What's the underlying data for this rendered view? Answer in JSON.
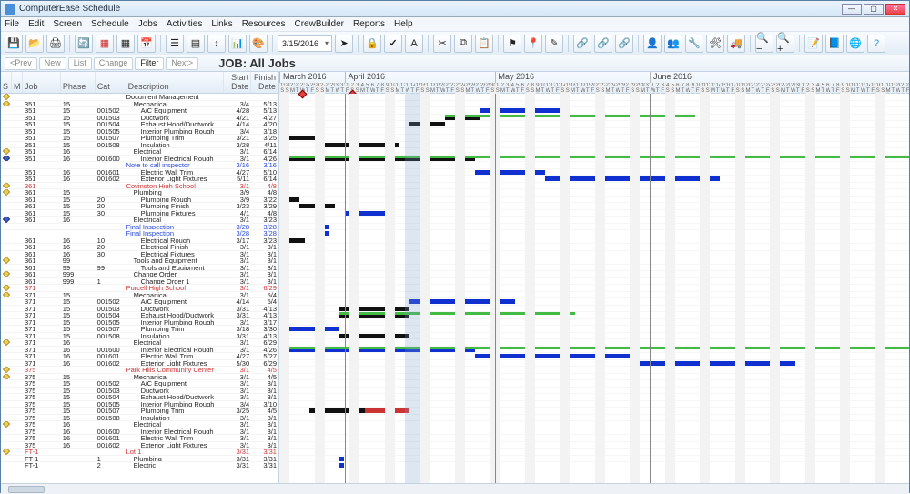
{
  "window": {
    "title": "ComputerEase Schedule"
  },
  "menus": [
    "File",
    "Edit",
    "Screen",
    "Schedule",
    "Jobs",
    "Activities",
    "Links",
    "Resources",
    "CrewBuilder",
    "Reports",
    "Help"
  ],
  "nav": {
    "prev": "<Prev",
    "new": "New",
    "list": "List",
    "change": "Change",
    "filter": "Filter",
    "next": "Next>"
  },
  "toolbar": {
    "date": "3/15/2016"
  },
  "heading": "JOB: All Jobs",
  "columns": {
    "s": "S",
    "m": "M",
    "job": "Job",
    "phase": "Phase",
    "cat": "Cat",
    "desc": "Description",
    "start": "Start Date",
    "finish": "Finish Date"
  },
  "months": [
    {
      "label": "March 2016",
      "start": 0
    },
    {
      "label": "April 2016",
      "start": 13
    },
    {
      "label": "May 2016",
      "start": 43
    },
    {
      "label": "June 2016",
      "start": 74
    }
  ],
  "timeline": {
    "startDay": 19,
    "totalDays": 126,
    "dayWidth": 5.5,
    "today": 26,
    "bandStart": 25,
    "bandWidth": 3
  },
  "rows": [
    {
      "m": "y",
      "job": "",
      "desc": "Document Management"
    },
    {
      "m": "y",
      "job": "351",
      "phase": "15",
      "desc": "Mechanical",
      "start": "3/4",
      "fin": "5/13"
    },
    {
      "job": "351",
      "phase": "15",
      "cat": "001502",
      "desc": "A/C Equipment",
      "start": "4/28",
      "fin": "5/13",
      "bars": [
        {
          "s": 40,
          "e": 55
        }
      ]
    },
    {
      "job": "351",
      "phase": "15",
      "cat": "001503",
      "desc": "Ductwork",
      "start": "4/21",
      "fin": "4/27",
      "bars": [
        {
          "s": 33,
          "e": 39,
          "cls": "blk"
        },
        {
          "s": 33,
          "e": 82,
          "cls": "grn"
        }
      ]
    },
    {
      "job": "351",
      "phase": "15",
      "cat": "001504",
      "desc": "Exhaust Hood/Ductwork",
      "start": "4/14",
      "fin": "4/20",
      "bars": [
        {
          "s": 26,
          "e": 32,
          "cls": "blk"
        }
      ]
    },
    {
      "job": "351",
      "phase": "15",
      "cat": "001505",
      "desc": "Interior Plumbing Rough",
      "start": "3/4",
      "fin": "3/18",
      "bars": [
        {
          "s": -15,
          "e": -1,
          "cls": "blk"
        }
      ]
    },
    {
      "job": "351",
      "phase": "15",
      "cat": "001507",
      "desc": "Plumbing Trim",
      "start": "3/21",
      "fin": "3/25",
      "bars": [
        {
          "s": 2,
          "e": 6,
          "cls": "blk"
        }
      ]
    },
    {
      "job": "351",
      "phase": "15",
      "cat": "001508",
      "desc": "Insulation",
      "start": "3/28",
      "fin": "4/11",
      "bars": [
        {
          "s": 9,
          "e": 23,
          "cls": "blk"
        }
      ]
    },
    {
      "m": "y",
      "job": "351",
      "phase": "16",
      "desc": "Electrical",
      "start": "3/1",
      "fin": "6/14"
    },
    {
      "m": "b",
      "job": "351",
      "phase": "16",
      "cat": "001600",
      "desc": "Interior Electrical Rough",
      "start": "3/1",
      "fin": "4/26",
      "bars": [
        {
          "s": -18,
          "e": 38,
          "cls": "blk"
        },
        {
          "s": -18,
          "e": 126,
          "cls": "grn"
        }
      ]
    },
    {
      "job": "",
      "desc": "Note to call inspector",
      "start": "3/16",
      "fin": "3/16",
      "cls": "blue"
    },
    {
      "job": "351",
      "phase": "16",
      "cat": "001601",
      "desc": "Electric Wall Trim",
      "start": "4/27",
      "fin": "5/10",
      "bars": [
        {
          "s": 39,
          "e": 52
        }
      ]
    },
    {
      "job": "351",
      "phase": "16",
      "cat": "001602",
      "desc": "Exterior Light Fixtures",
      "start": "5/11",
      "fin": "6/14",
      "bars": [
        {
          "s": 53,
          "e": 87
        }
      ]
    },
    {
      "m": "y",
      "job": "361",
      "desc": "Covington High School",
      "start": "3/1",
      "fin": "4/8",
      "cls": "red"
    },
    {
      "m": "y",
      "job": "361",
      "phase": "15",
      "desc": "Plumbing",
      "start": "3/9",
      "fin": "4/8"
    },
    {
      "job": "361",
      "phase": "15",
      "cat": "20",
      "desc": "Plumbing Rough",
      "start": "3/9",
      "fin": "3/22",
      "bars": [
        {
          "s": -10,
          "e": 3,
          "cls": "blk"
        }
      ]
    },
    {
      "job": "361",
      "phase": "15",
      "cat": "20",
      "desc": "Plumbing Finish",
      "start": "3/23",
      "fin": "3/29",
      "bars": [
        {
          "s": 4,
          "e": 10,
          "cls": "blk"
        }
      ]
    },
    {
      "job": "361",
      "phase": "15",
      "cat": "30",
      "desc": "Plumbing Fixtures",
      "start": "4/1",
      "fin": "4/8",
      "bars": [
        {
          "s": 13,
          "e": 20
        }
      ]
    },
    {
      "m": "b",
      "job": "361",
      "phase": "16",
      "desc": "Electrical",
      "start": "3/1",
      "fin": "3/23"
    },
    {
      "job": "",
      "desc": "Final Inspection",
      "start": "3/28",
      "fin": "3/28",
      "cls": "blue",
      "sq": 9
    },
    {
      "job": "",
      "desc": "Final Inspection",
      "start": "3/28",
      "fin": "3/28",
      "cls": "blue",
      "sq": 9
    },
    {
      "job": "361",
      "phase": "16",
      "cat": "10",
      "desc": "Electrical Rough",
      "start": "3/17",
      "fin": "3/23",
      "bars": [
        {
          "s": -2,
          "e": 4,
          "cls": "blk"
        }
      ]
    },
    {
      "job": "361",
      "phase": "16",
      "cat": "20",
      "desc": "Electrical Finish",
      "start": "3/1",
      "fin": "3/1"
    },
    {
      "job": "361",
      "phase": "16",
      "cat": "30",
      "desc": "Electrical Fixtures",
      "start": "3/1",
      "fin": "3/1"
    },
    {
      "m": "y",
      "job": "361",
      "phase": "99",
      "desc": "Tools and Equipment",
      "start": "3/1",
      "fin": "3/1"
    },
    {
      "job": "361",
      "phase": "99",
      "cat": "99",
      "desc": "Tools and Equipment",
      "start": "3/1",
      "fin": "3/1"
    },
    {
      "m": "y",
      "job": "361",
      "phase": "999",
      "desc": "Change Order",
      "start": "3/1",
      "fin": "3/1"
    },
    {
      "job": "361",
      "phase": "999",
      "cat": "1",
      "desc": "Change Order 1",
      "start": "3/1",
      "fin": "3/1"
    },
    {
      "m": "y",
      "job": "371",
      "desc": "Purcell High School",
      "start": "3/1",
      "fin": "6/29",
      "cls": "red"
    },
    {
      "m": "y",
      "job": "371",
      "phase": "15",
      "desc": "Mechanical",
      "start": "3/1",
      "fin": "5/4"
    },
    {
      "job": "371",
      "phase": "15",
      "cat": "001502",
      "desc": "A/C Equipment",
      "start": "4/14",
      "fin": "5/4",
      "bars": [
        {
          "s": 26,
          "e": 46
        }
      ]
    },
    {
      "job": "371",
      "phase": "15",
      "cat": "001503",
      "desc": "Ductwork",
      "start": "3/31",
      "fin": "4/13",
      "bars": [
        {
          "s": 12,
          "e": 25,
          "cls": "blk"
        }
      ]
    },
    {
      "job": "371",
      "phase": "15",
      "cat": "001504",
      "desc": "Exhaust Hood/Ductwork",
      "start": "3/31",
      "fin": "4/13",
      "bars": [
        {
          "s": 12,
          "e": 25,
          "cls": "blk"
        },
        {
          "s": 12,
          "e": 58,
          "cls": "grn"
        }
      ]
    },
    {
      "job": "371",
      "phase": "15",
      "cat": "001505",
      "desc": "Interior Plumbing Rough",
      "start": "3/1",
      "fin": "3/17",
      "bars": [
        {
          "s": -18,
          "e": -2,
          "cls": "blk"
        }
      ]
    },
    {
      "job": "371",
      "phase": "15",
      "cat": "001507",
      "desc": "Plumbing Trim",
      "start": "3/18",
      "fin": "3/30",
      "bars": [
        {
          "s": -1,
          "e": 11
        }
      ]
    },
    {
      "job": "371",
      "phase": "15",
      "cat": "001508",
      "desc": "Insulation",
      "start": "3/31",
      "fin": "4/13",
      "bars": [
        {
          "s": 12,
          "e": 25,
          "cls": "blk"
        }
      ]
    },
    {
      "m": "y",
      "job": "371",
      "phase": "16",
      "desc": "Electrical",
      "start": "3/1",
      "fin": "6/29"
    },
    {
      "job": "371",
      "phase": "16",
      "cat": "001600",
      "desc": "Interior Electrical Rough",
      "start": "3/1",
      "fin": "4/26",
      "bars": [
        {
          "s": -18,
          "e": 38
        },
        {
          "s": -18,
          "e": 126,
          "cls": "grn"
        }
      ]
    },
    {
      "job": "371",
      "phase": "16",
      "cat": "001601",
      "desc": "Electric Wall Trim",
      "start": "4/27",
      "fin": "5/27",
      "bars": [
        {
          "s": 39,
          "e": 69
        }
      ]
    },
    {
      "job": "371",
      "phase": "16",
      "cat": "001602",
      "desc": "Exterior Light Fixtures",
      "start": "5/30",
      "fin": "6/29",
      "bars": [
        {
          "s": 72,
          "e": 102
        }
      ]
    },
    {
      "m": "y",
      "job": "375",
      "desc": "Park Hills Community Center",
      "start": "3/1",
      "fin": "4/5",
      "cls": "red"
    },
    {
      "m": "y",
      "job": "375",
      "phase": "15",
      "desc": "Mechanical",
      "start": "3/1",
      "fin": "4/5"
    },
    {
      "job": "375",
      "phase": "15",
      "cat": "001502",
      "desc": "A/C Equipment",
      "start": "3/1",
      "fin": "3/1"
    },
    {
      "job": "375",
      "phase": "15",
      "cat": "001503",
      "desc": "Ductwork",
      "start": "3/1",
      "fin": "3/1"
    },
    {
      "job": "375",
      "phase": "15",
      "cat": "001504",
      "desc": "Exhaust Hood/Ductwork",
      "start": "3/1",
      "fin": "3/1"
    },
    {
      "job": "375",
      "phase": "15",
      "cat": "001505",
      "desc": "Interior Plumbing Rough",
      "start": "3/4",
      "fin": "3/10"
    },
    {
      "job": "375",
      "phase": "15",
      "cat": "001507",
      "desc": "Plumbing Trim",
      "start": "3/25",
      "fin": "4/5",
      "bars": [
        {
          "s": 6,
          "e": 17,
          "cls": "blk"
        },
        {
          "s": 17,
          "e": 25,
          "cls": "redbar"
        }
      ]
    },
    {
      "job": "375",
      "phase": "15",
      "cat": "001508",
      "desc": "Insulation",
      "start": "3/1",
      "fin": "3/1"
    },
    {
      "m": "y",
      "job": "375",
      "phase": "16",
      "desc": "Electrical",
      "start": "3/1",
      "fin": "3/1"
    },
    {
      "job": "375",
      "phase": "16",
      "cat": "001600",
      "desc": "Interior Electrical Rough",
      "start": "3/1",
      "fin": "3/1"
    },
    {
      "job": "375",
      "phase": "16",
      "cat": "001601",
      "desc": "Electric Wall Trim",
      "start": "3/1",
      "fin": "3/1"
    },
    {
      "job": "375",
      "phase": "16",
      "cat": "001602",
      "desc": "Exterior Light Fixtures",
      "start": "3/1",
      "fin": "3/1"
    },
    {
      "m": "y",
      "job": "FT-1",
      "desc": "Lot 1",
      "start": "3/31",
      "fin": "3/31",
      "cls": "red"
    },
    {
      "job": "FT-1",
      "cat": "1",
      "desc": "Plumbing",
      "start": "3/31",
      "fin": "3/31",
      "sq": 12
    },
    {
      "job": "FT-1",
      "cat": "2",
      "desc": "Electric",
      "start": "3/31",
      "fin": "3/31",
      "sq": 12
    }
  ]
}
